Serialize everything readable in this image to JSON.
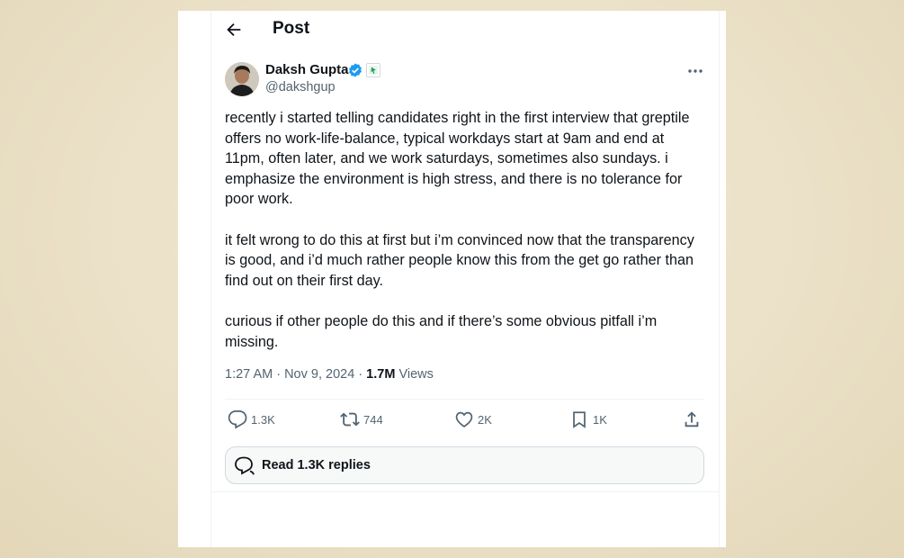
{
  "header": {
    "title": "Post"
  },
  "author": {
    "name": "Daksh Gupta",
    "handle": "@dakshgup"
  },
  "post": {
    "paragraphs": [
      "recently i started telling candidates right in the first interview that greptile offers no work-life-balance, typical workdays start at 9am and end at 11pm, often later, and we work saturdays, sometimes also sundays. i emphasize the environment is high stress, and there is no tolerance for poor work.",
      "it felt wrong to do this at first but i’m convinced now that the transparency is good, and i’d much rather people know this from the get go rather than find out on their first day.",
      "curious if other people do this and if there’s some obvious pitfall i’m missing."
    ],
    "time": "1:27 AM · Nov 9, 2024 · ",
    "views_count": "1.7M",
    "views_label": " Views"
  },
  "actions": {
    "replies": "1.3K",
    "reposts": "744",
    "likes": "2K",
    "bookmarks": "1K"
  },
  "read_replies": "Read 1.3K replies",
  "colors": {
    "text": "#0f1419",
    "muted": "#536471",
    "verified": "#1d9bf0",
    "border": "#eff3f4"
  },
  "icons": [
    "back-arrow-icon",
    "verified-badge-icon",
    "affiliate-badge-icon",
    "more-icon",
    "reply-icon",
    "repost-icon",
    "like-icon",
    "bookmark-icon",
    "share-icon",
    "conversation-icon"
  ]
}
